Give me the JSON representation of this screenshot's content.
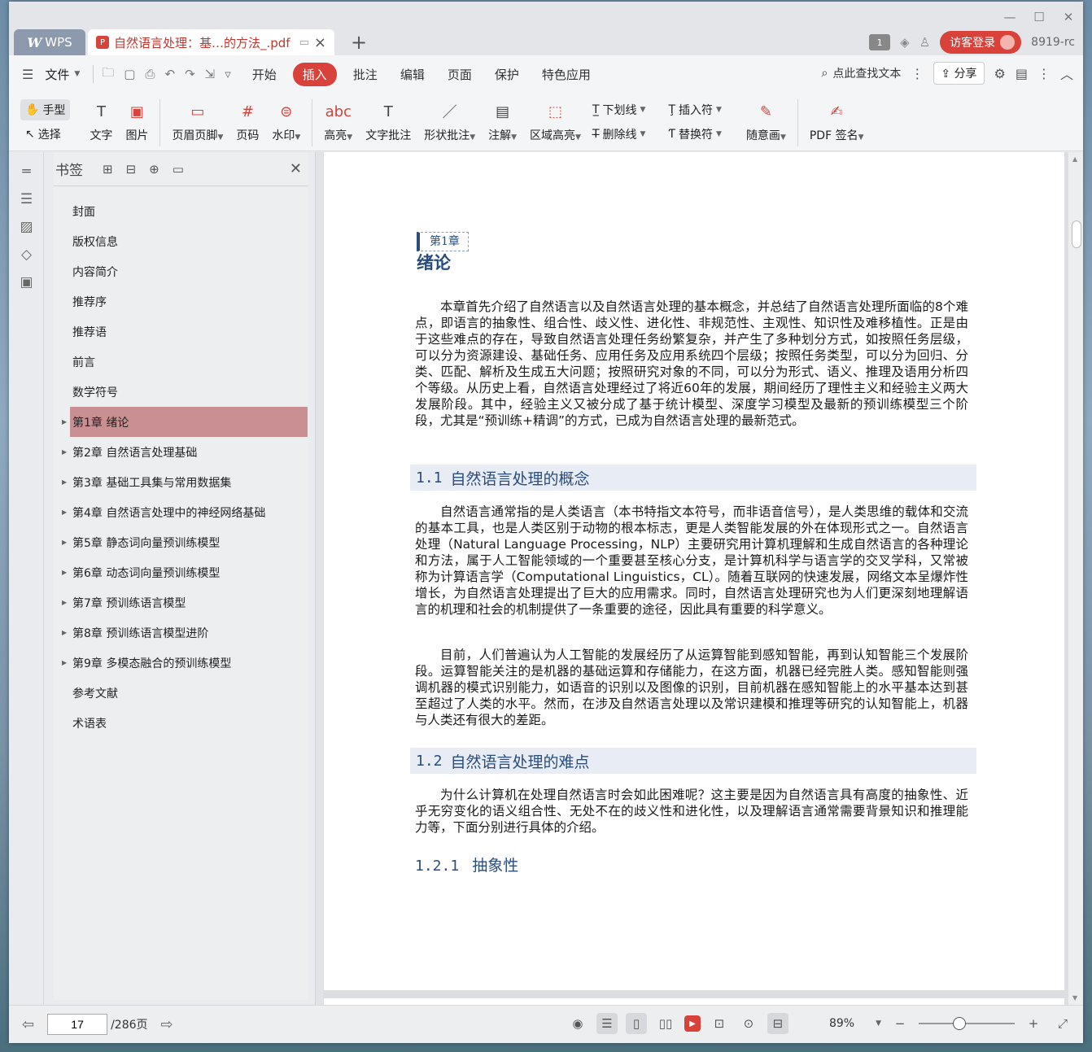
{
  "titlebar": {
    "app_name": "WPS",
    "doc_tab_title": "自然语言处理：基…的方法_.pdf",
    "tab_count": "1",
    "login_label": "访客登录",
    "user_id": "8919-rc"
  },
  "menubar": {
    "file_label": "文件",
    "tabs": [
      "开始",
      "插入",
      "批注",
      "编辑",
      "页面",
      "保护",
      "特色应用"
    ],
    "active_tab": "插入",
    "search_label": "点此查找文本",
    "share_label": "分享"
  },
  "ribbon": {
    "hand_label": "手型",
    "select_label": "选择",
    "text_label": "文字",
    "image_label": "图片",
    "header_footer_label": "页眉页脚",
    "page_num_label": "页码",
    "watermark_label": "水印",
    "highlight_label": "高亮",
    "text_comment_label": "文字批注",
    "shape_comment_label": "形状批注",
    "note_label": "注解",
    "area_highlight_label": "区域高亮",
    "underline_label": "下划线",
    "strikethrough_label": "删除线",
    "insert_symbol_label": "插入符",
    "replace_symbol_label": "替换符",
    "freehand_label": "随意画",
    "pdf_sign_label": "PDF 签名"
  },
  "bookmarks": {
    "title": "书签",
    "items": [
      {
        "label": "封面",
        "expandable": false
      },
      {
        "label": "版权信息",
        "expandable": false
      },
      {
        "label": "内容简介",
        "expandable": false
      },
      {
        "label": "推荐序",
        "expandable": false
      },
      {
        "label": "推荐语",
        "expandable": false
      },
      {
        "label": "前言",
        "expandable": false
      },
      {
        "label": "数学符号",
        "expandable": false
      },
      {
        "label": "第1章 绪论",
        "expandable": true
      },
      {
        "label": "第2章 自然语言处理基础",
        "expandable": true
      },
      {
        "label": "第3章 基础工具集与常用数据集",
        "expandable": true
      },
      {
        "label": "第4章 自然语言处理中的神经网络基础",
        "expandable": true
      },
      {
        "label": "第5章 静态词向量预训练模型",
        "expandable": true
      },
      {
        "label": "第6章 动态词向量预训练模型",
        "expandable": true
      },
      {
        "label": "第7章 预训练语言模型",
        "expandable": true
      },
      {
        "label": "第8章 预训练语言模型进阶",
        "expandable": true
      },
      {
        "label": "第9章 多模态融合的预训练模型",
        "expandable": true
      },
      {
        "label": "参考文献",
        "expandable": false
      },
      {
        "label": "术语表",
        "expandable": false
      }
    ],
    "selected": "第1章 绪论"
  },
  "document": {
    "chapter_label": "第1章",
    "chapter_title": "绪论",
    "intro_paragraph": "本章首先介绍了自然语言以及自然语言处理的基本概念，并总结了自然语言处理所面临的8个难点，即语言的抽象性、组合性、歧义性、进化性、非规范性、主观性、知识性及难移植性。正是由于这些难点的存在，导致自然语言处理任务纷繁复杂，并产生了多种划分方式，如按照任务层级，可以分为资源建设、基础任务、应用任务及应用系统四个层级；按照任务类型，可以分为回归、分类、匹配、解析及生成五大问题；按照研究对象的不同，可以分为形式、语义、推理及语用分析四个等级。从历史上看，自然语言处理经过了将近60年的发展，期间经历了理性主义和经验主义两大发展阶段。其中，经验主义又被分成了基于统计模型、深度学习模型及最新的预训练模型三个阶段，尤其是“预训练+精调”的方式，已成为自然语言处理的最新范式。",
    "section1_num": "1.1",
    "section1_title": "自然语言处理的概念",
    "section1_para1": "自然语言通常指的是人类语言（本书特指文本符号，而非语音信号），是人类思维的载体和交流的基本工具，也是人类区别于动物的根本标志，更是人类智能发展的外在体现形式之一。自然语言处理（Natural Language Processing，NLP）主要研究用计算机理解和生成自然语言的各种理论和方法，属于人工智能领域的一个重要甚至核心分支，是计算机科学与语言学的交叉学科，又常被称为计算语言学（Computational Linguistics，CL）。随着互联网的快速发展，网络文本呈爆炸性增长，为自然语言处理提出了巨大的应用需求。同时，自然语言处理研究也为人们更深刻地理解语言的机理和社会的机制提供了一条重要的途径，因此具有重要的科学意义。",
    "section1_para2": "目前，人们普遍认为人工智能的发展经历了从运算智能到感知智能，再到认知智能三个发展阶段。运算智能关注的是机器的基础运算和存储能力，在这方面，机器已经完胜人类。感知智能则强调机器的模式识别能力，如语音的识别以及图像的识别，目前机器在感知智能上的水平基本达到甚至超过了人类的水平。然而，在涉及自然语言处理以及常识建模和推理等研究的认知智能上，机器与人类还有很大的差距。",
    "section2_num": "1.2",
    "section2_title": "自然语言处理的难点",
    "section2_para1": "为什么计算机在处理自然语言时会如此困难呢？这主要是因为自然语言具有高度的抽象性、近乎无穷变化的语义组合性、无处不在的歧义性和进化性，以及理解语言通常需要背景知识和推理能力等，下面分别进行具体的介绍。",
    "subsection_num": "1.2.1",
    "subsection_title": "抽象性"
  },
  "statusbar": {
    "current_page": "17",
    "total_pages": "/286页",
    "zoom": "89%",
    "zoom_fraction": 0.42
  },
  "colors": {
    "accent": "#d9423b",
    "heading_blue": "#2a4d7c",
    "bookmark_selected": "#c98f92"
  }
}
